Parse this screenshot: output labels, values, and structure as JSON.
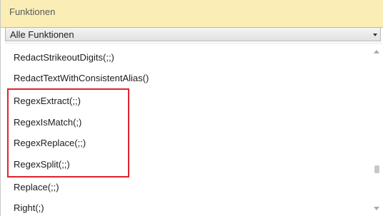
{
  "panel": {
    "title": "Funktionen",
    "category_select": {
      "value": "Alle Funktionen"
    },
    "functions": [
      "RedactStrikeoutDigits(;;)",
      "RedactTextWithConsistentAlias()",
      "RegexExtract(;;)",
      "RegexIsMatch(;)",
      "RegexReplace(;;)",
      "RegexSplit(;;)",
      "Replace(;;)",
      "Right(;)"
    ],
    "highlight_color": "#e0232c",
    "header_color": "#fbedb6"
  }
}
